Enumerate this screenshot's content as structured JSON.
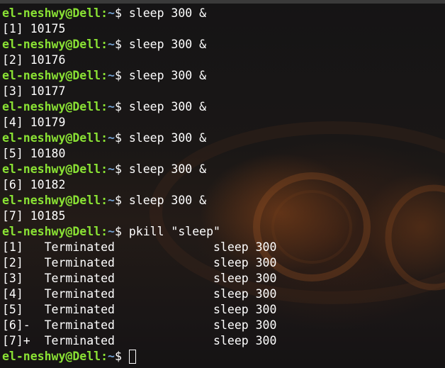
{
  "prompt": {
    "user_host": "el-neshwy@Dell",
    "path": "~",
    "symbol": "$"
  },
  "lines": [
    {
      "type": "prompt",
      "command": "sleep 300 &"
    },
    {
      "type": "output",
      "text": "[1] 10175"
    },
    {
      "type": "prompt",
      "command": "sleep 300 &"
    },
    {
      "type": "output",
      "text": "[2] 10176"
    },
    {
      "type": "prompt",
      "command": "sleep 300 &"
    },
    {
      "type": "output",
      "text": "[3] 10177"
    },
    {
      "type": "prompt",
      "command": "sleep 300 &"
    },
    {
      "type": "output",
      "text": "[4] 10179"
    },
    {
      "type": "prompt",
      "command": "sleep 300 &"
    },
    {
      "type": "output",
      "text": "[5] 10180"
    },
    {
      "type": "prompt",
      "command": "sleep 300 &"
    },
    {
      "type": "output",
      "text": "[6] 10182"
    },
    {
      "type": "prompt",
      "command": "sleep 300 &"
    },
    {
      "type": "output",
      "text": "[7] 10185"
    },
    {
      "type": "prompt",
      "command": "pkill \"sleep\""
    },
    {
      "type": "output",
      "text": "[1]   Terminated              sleep 300"
    },
    {
      "type": "output",
      "text": "[2]   Terminated              sleep 300"
    },
    {
      "type": "output",
      "text": "[3]   Terminated              sleep 300"
    },
    {
      "type": "output",
      "text": "[4]   Terminated              sleep 300"
    },
    {
      "type": "output",
      "text": "[5]   Terminated              sleep 300"
    },
    {
      "type": "output",
      "text": "[6]-  Terminated              sleep 300"
    },
    {
      "type": "output",
      "text": "[7]+  Terminated              sleep 300"
    },
    {
      "type": "prompt",
      "command": "",
      "cursor": true
    }
  ],
  "colors": {
    "user_host": "#8ae234",
    "path": "#729fcf",
    "text": "#ffffff",
    "background": "#151314"
  }
}
